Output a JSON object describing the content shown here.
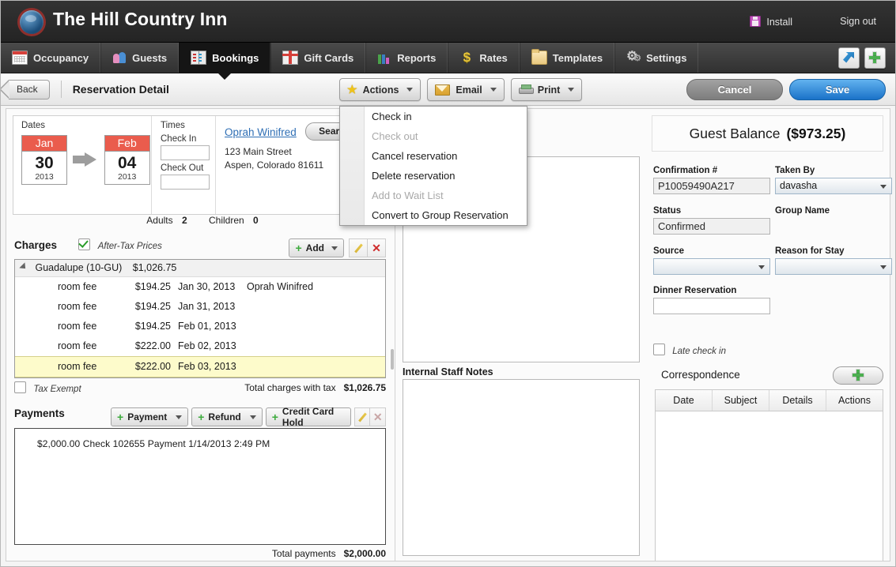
{
  "header": {
    "brand": "The Hill Country Inn",
    "install": "Install",
    "sign_out": "Sign out"
  },
  "nav": {
    "tabs": [
      {
        "label": "Occupancy",
        "icon": "calendar-icon",
        "active": false
      },
      {
        "label": "Guests",
        "icon": "people-icon",
        "active": false
      },
      {
        "label": "Bookings",
        "icon": "book-icon",
        "active": true
      },
      {
        "label": "Gift Cards",
        "icon": "gift-icon",
        "active": false
      },
      {
        "label": "Reports",
        "icon": "bar-chart-icon",
        "active": false
      },
      {
        "label": "Rates",
        "icon": "dollar-icon",
        "active": false
      },
      {
        "label": "Templates",
        "icon": "folder-icon",
        "active": false
      },
      {
        "label": "Settings",
        "icon": "gear-icon",
        "active": false
      }
    ],
    "buttons": [
      "popout-icon",
      "add-icon"
    ]
  },
  "toolbar": {
    "back": "Back",
    "page_title": "Reservation Detail",
    "actions": "Actions",
    "email": "Email",
    "print": "Print",
    "cancel": "Cancel",
    "save": "Save"
  },
  "actions_menu": {
    "items": [
      {
        "label": "Check in",
        "disabled": false
      },
      {
        "label": "Check out",
        "disabled": true
      },
      {
        "label": "Cancel reservation",
        "disabled": false
      },
      {
        "label": "Delete reservation",
        "disabled": false
      },
      {
        "label": "Add to Wait List",
        "disabled": true
      },
      {
        "label": "Convert to Group Reservation",
        "disabled": false
      }
    ]
  },
  "dates": {
    "title": "Dates",
    "check_in": {
      "month": "Jan",
      "day": "30",
      "year": "2013"
    },
    "check_out": {
      "month": "Feb",
      "day": "04",
      "year": "2013"
    }
  },
  "times": {
    "title": "Times",
    "check_in_label": "Check In",
    "check_in_value": "",
    "check_out_label": "Check Out",
    "check_out_value": ""
  },
  "guest": {
    "name": "Oprah Winifred",
    "search_button": "Search",
    "address_line1": "123 Main Street",
    "address_line2": "Aspen,  Colorado 81611",
    "adults_label": "Adults",
    "adults_value": "2",
    "children_label": "Children",
    "children_value": "0"
  },
  "charges": {
    "title": "Charges",
    "after_tax_label": "After-Tax Prices",
    "after_tax_checked": true,
    "add_button": "Add",
    "group": {
      "name": "Guadalupe (10-GU)",
      "amount": "$1,026.75"
    },
    "rows": [
      {
        "desc": "room fee",
        "amount": "$194.25",
        "date": "Jan 30, 2013",
        "guest": "Oprah Winifred",
        "selected": false
      },
      {
        "desc": "room fee",
        "amount": "$194.25",
        "date": "Jan 31, 2013",
        "guest": "",
        "selected": false
      },
      {
        "desc": "room fee",
        "amount": "$194.25",
        "date": "Feb 01, 2013",
        "guest": "",
        "selected": false
      },
      {
        "desc": "room fee",
        "amount": "$222.00",
        "date": "Feb 02, 2013",
        "guest": "",
        "selected": false
      },
      {
        "desc": "room fee",
        "amount": "$222.00",
        "date": "Feb 03, 2013",
        "guest": "",
        "selected": true
      }
    ],
    "tax_exempt_label": "Tax Exempt",
    "tax_exempt_checked": false,
    "total_label": "Total charges with tax",
    "total_value": "$1,026.75"
  },
  "payments": {
    "title": "Payments",
    "payment_button": "Payment",
    "refund_button": "Refund",
    "credit_card_hold_button": "Credit Card Hold",
    "entries": [
      "$2,000.00 Check   102655  Payment 1/14/2013 2:49 PM"
    ],
    "total_label": "Total payments",
    "total_value": "$2,000.00"
  },
  "notes": {
    "internal_staff_notes_label": "Internal Staff Notes",
    "guest_notes_value": "",
    "internal_staff_notes_value": ""
  },
  "balance": {
    "label": "Guest Balance",
    "value": "($973.25)"
  },
  "fields": {
    "confirmation_label": "Confirmation #",
    "confirmation_value": "P10059490A217",
    "taken_by_label": "Taken By",
    "taken_by_value": "davasha",
    "status_label": "Status",
    "status_value": "Confirmed",
    "group_name_label": "Group Name",
    "group_name_value": "",
    "source_label": "Source",
    "source_value": "",
    "reason_for_stay_label": "Reason for Stay",
    "reason_for_stay_value": "",
    "dinner_reservation_label": "Dinner Reservation",
    "dinner_reservation_value": "",
    "late_check_in_label": "Late check in",
    "late_check_in_checked": false
  },
  "correspondence": {
    "title": "Correspondence",
    "columns": [
      "Date",
      "Subject",
      "Details",
      "Actions"
    ],
    "rows": []
  },
  "colors": {
    "accent_red": "#ea5c4d",
    "link_blue": "#2f6fb5",
    "save_blue": "#1a72c8",
    "highlight_yellow": "#fdfbcb",
    "green": "#3cab3c"
  }
}
